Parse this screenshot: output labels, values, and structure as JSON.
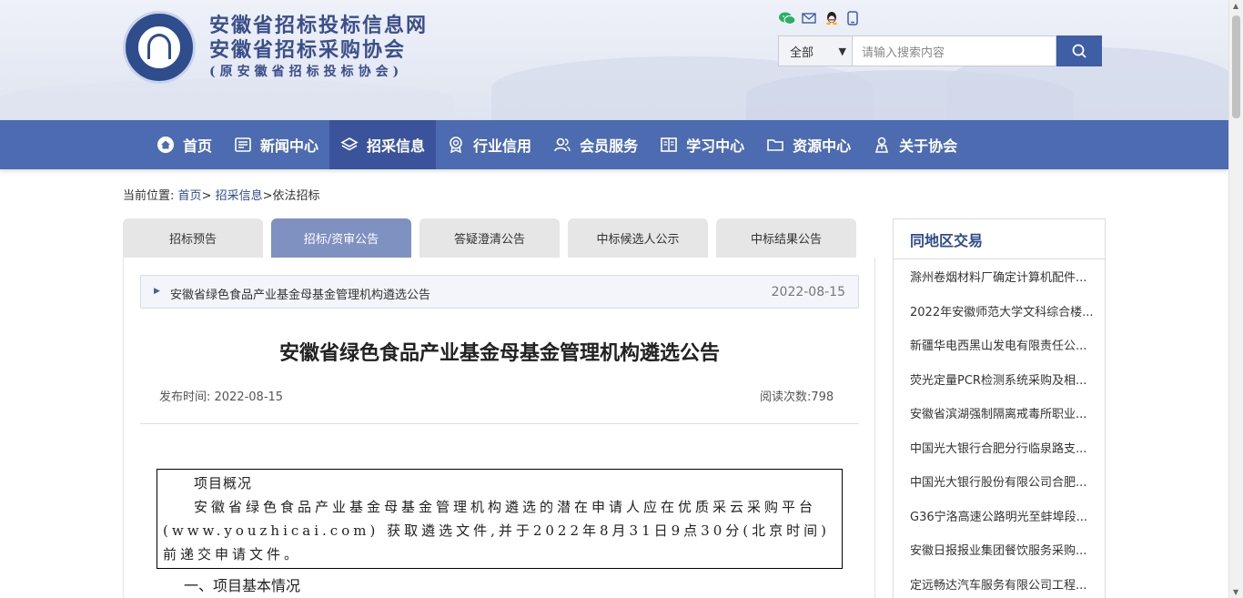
{
  "header": {
    "title_line1": "安徽省招标投标信息网",
    "title_line2": "安徽省招标采购协会",
    "title_line3": "(原安徽省招标投标协会)"
  },
  "search": {
    "scope_selected": "全部",
    "placeholder": "请输入搜索内容"
  },
  "nav": {
    "items": [
      {
        "label": "首页",
        "icon": "home-icon"
      },
      {
        "label": "新闻中心",
        "icon": "news-icon"
      },
      {
        "label": "招采信息",
        "icon": "layers-icon"
      },
      {
        "label": "行业信用",
        "icon": "badge-icon"
      },
      {
        "label": "会员服务",
        "icon": "users-icon"
      },
      {
        "label": "学习中心",
        "icon": "book-icon"
      },
      {
        "label": "资源中心",
        "icon": "folder-icon"
      },
      {
        "label": "关于协会",
        "icon": "person-icon"
      }
    ],
    "active": "招采信息"
  },
  "breadcrumb": {
    "prefix": "当前位置:",
    "home": "首页",
    "sep1": ">",
    "cat": "招采信息",
    "sep2": ">",
    "current": "依法招标"
  },
  "tabs": [
    "招标预告",
    "招标/资审公告",
    "答疑澄清公告",
    "中标候选人公示",
    "中标结果公告"
  ],
  "list_item": {
    "title": "安徽省绿色食品产业基金母基金管理机构遴选公告",
    "date": "2022-08-15"
  },
  "article": {
    "title": "安徽省绿色食品产业基金母基金管理机构遴选公告",
    "publish": "发布时间: 2022-08-15",
    "views": "阅读次数:798",
    "box_heading": "项目概况",
    "box_para": "安徽省绿色食品产业基金母基金管理机构遴选的潜在申请人应在优质采云采购平台(www.youzhicai.com) 获取遴选文件,并于2022年8月31日9点30分(北京时间)前递交申请文件。",
    "section1": "一、项目基本情况"
  },
  "sidebar": {
    "heading": "同地区交易",
    "items": [
      "滁州卷烟材料厂确定计算机配件...",
      "2022年安徽师范大学文科综合楼...",
      "新疆华电西黑山发电有限责任公...",
      "荧光定量PCR检测系统采购及相...",
      "安徽省滨湖强制隔离戒毒所职业...",
      "中国光大银行合肥分行临泉路支...",
      "中国光大银行股份有限公司合肥...",
      "G36宁洛高速公路明光至蚌埠段...",
      "安徽日报报业集团餐饮服务采购...",
      "定远畅达汽车服务有限公司工程..."
    ]
  },
  "colors": {
    "nav_bg": "#4d6bb0",
    "nav_active": "#3b539a",
    "tab_active": "#7f91c0",
    "brand_blue": "#2f4c8c"
  }
}
